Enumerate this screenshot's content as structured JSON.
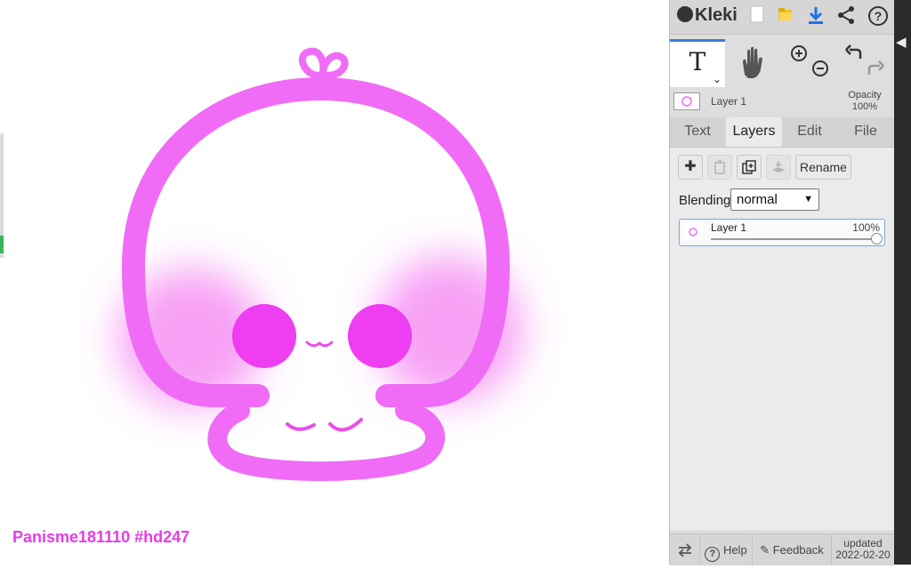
{
  "canvas": {
    "signature": "Panisme181110 #hd247",
    "colors": {
      "stroke": "#f06cf6",
      "blush": "#f7a0f5",
      "eyes": "#ef3df1",
      "mouth": "#e94fe8"
    }
  },
  "toolbar": {
    "app_name": "Kleki",
    "icons": [
      "new-image-icon",
      "open-folder-icon",
      "download-icon",
      "share-icon",
      "help-icon"
    ]
  },
  "tools": {
    "text_tool": "T",
    "icons": [
      "text-tool-icon",
      "hand-tool-icon",
      "zoom-in-icon",
      "zoom-out-icon",
      "undo-icon",
      "redo-icon"
    ]
  },
  "current_layer": {
    "name": "Layer 1",
    "opacity_label": "Opacity",
    "opacity_value": "100%"
  },
  "tabs": [
    {
      "label": "Text"
    },
    {
      "label": "Layers",
      "active": true
    },
    {
      "label": "Edit"
    },
    {
      "label": "File"
    }
  ],
  "layers_panel": {
    "rename_label": "Rename",
    "blending_label": "Blending",
    "blending_value": "normal",
    "layers": [
      {
        "name": "Layer 1",
        "opacity": "100%",
        "opacity_fraction": 1.0
      }
    ]
  },
  "footer": {
    "help_label": "Help",
    "feedback_label": "Feedback",
    "updated_label": "updated",
    "updated_date": "2022-02-20"
  },
  "accent_color": "#3d7bd4"
}
